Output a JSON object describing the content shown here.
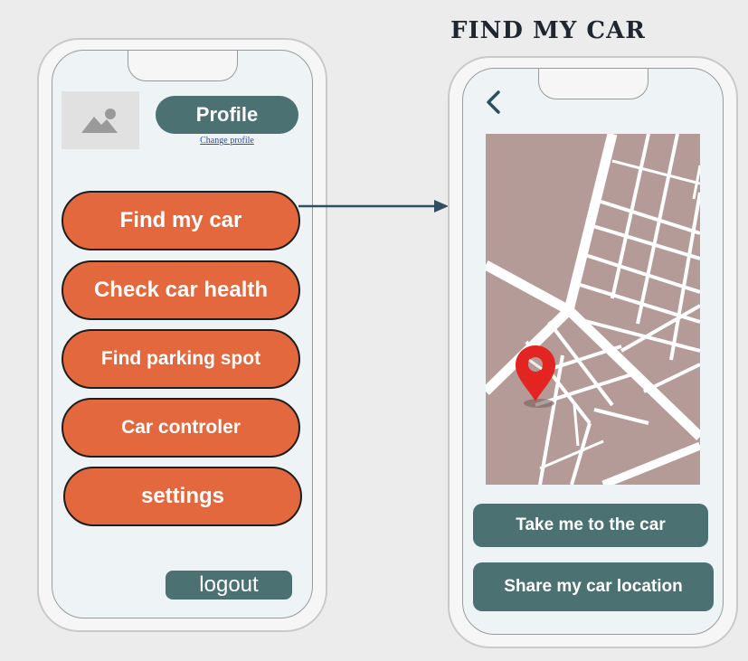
{
  "screen_title": "FIND MY CAR",
  "left_phone": {
    "profile_label": "Profile",
    "change_profile_link": "Change profile",
    "menu": [
      {
        "label": "Find my car"
      },
      {
        "label": "Check car health"
      },
      {
        "label": "Find parking spot"
      },
      {
        "label": "Car controler"
      },
      {
        "label": "settings"
      }
    ],
    "logout_label": "logout"
  },
  "right_phone": {
    "take_me_label": "Take me to the car",
    "share_location_label": "Share my car location"
  },
  "colors": {
    "menu_button": "#e4683d",
    "teal_button": "#4b7172",
    "map_block": "#b59b98",
    "map_road": "#ffffff",
    "pin": "#e32522",
    "background": "#ececec"
  },
  "icons": {
    "avatar": "image-placeholder-icon",
    "back": "chevron-left-icon",
    "pin": "map-pin-icon"
  }
}
